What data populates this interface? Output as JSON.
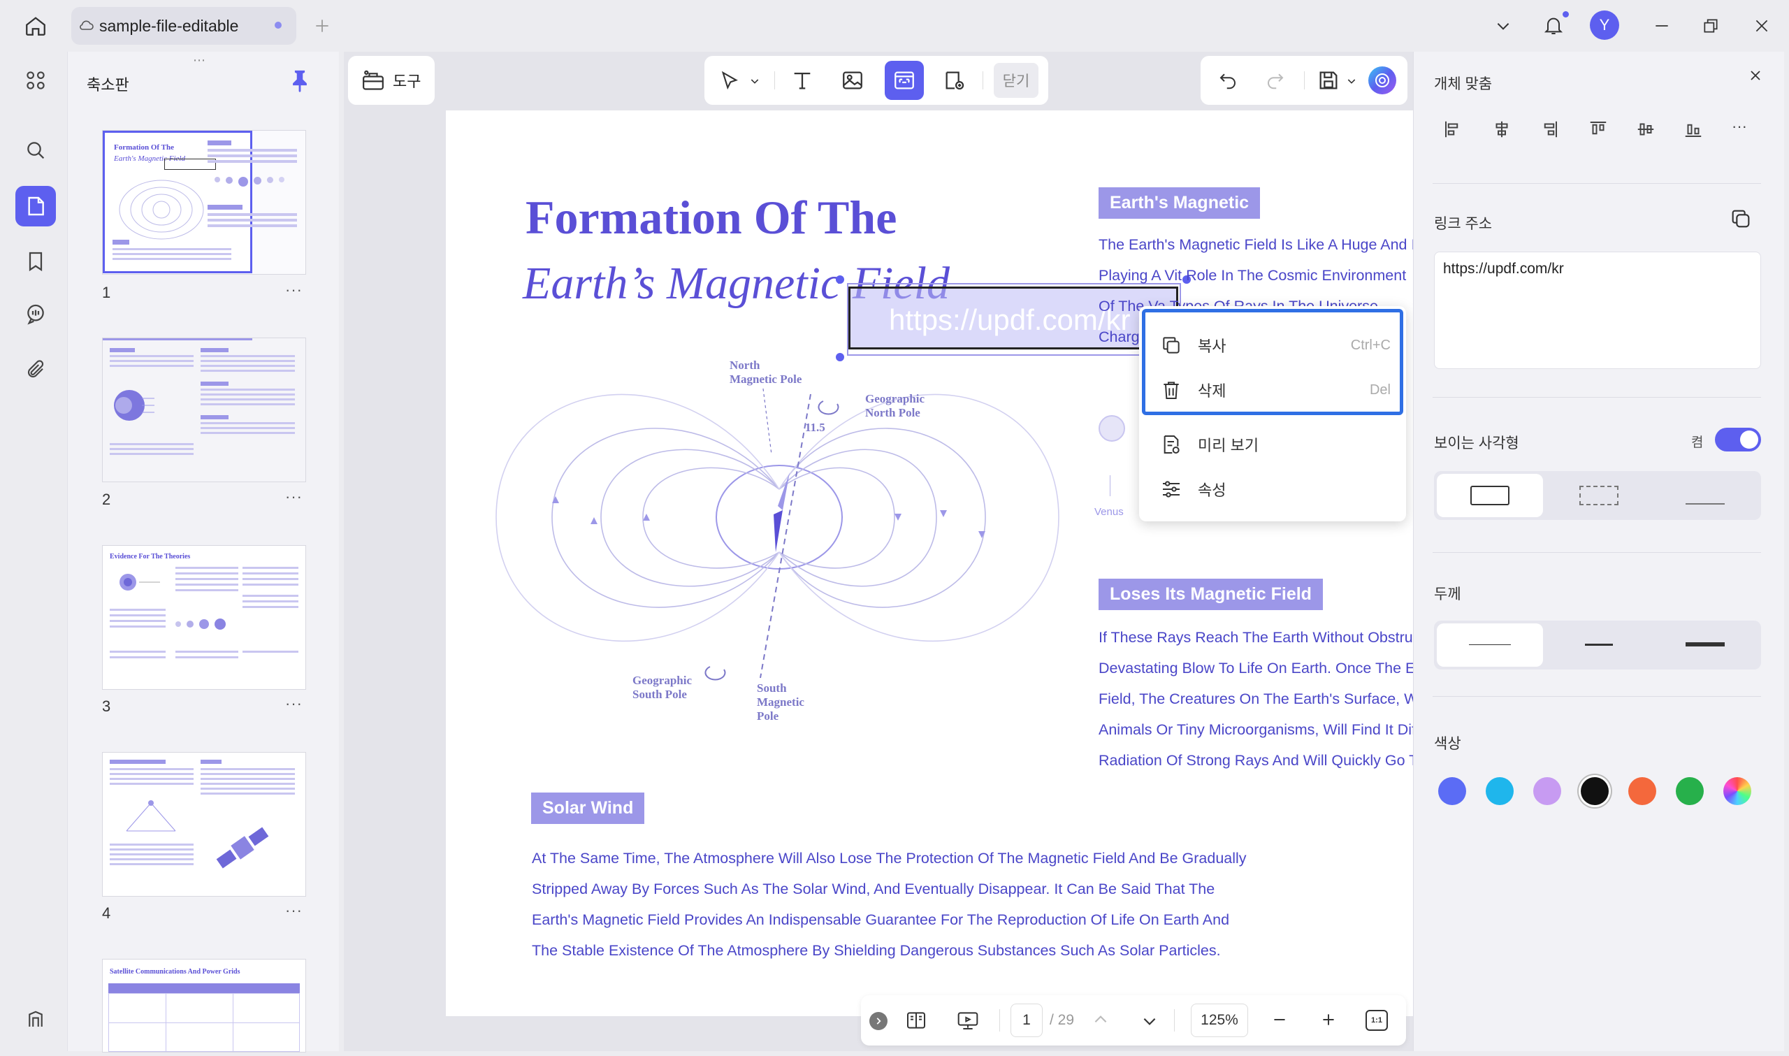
{
  "titlebar": {
    "tab_title": "sample-file-editable",
    "avatar_initial": "Y"
  },
  "thumbnails": {
    "panel_title": "축소판",
    "pages": [
      "1",
      "2",
      "3",
      "4"
    ],
    "more": "···",
    "thumb3_title": "Evidence For The Theories",
    "thumb5_title": "Satellite Communications And Power Grids"
  },
  "toolbar": {
    "tools_label": "도구",
    "close_label": "닫기"
  },
  "document": {
    "title_line1": "Formation Of The",
    "title_line2": "Earth’s Magnetic Field",
    "link_text": "https://updf.com/kr",
    "heading_earth": "Earth's Magnetic",
    "earth_lines": [
      "The Earth's Magnetic Field Is Like A Huge And In",
      "Playing A Vit    Role In The Cosmic Environment",
      "Of The Va          Types Of Rays In The Universe",
      "Charg"
    ],
    "heading_loses": "Loses Its Magnetic Field",
    "loses_lines": [
      "If These Rays Reach The Earth Without Obstruc",
      "Devastating Blow To Life On Earth. Once The Ea",
      "Field, The Creatures On The Earth's Surface, Wh",
      "Animals Or Tiny Microorganisms, Will Find It Diffi",
      "Radiation Of Strong Rays And Will Quickly Go To"
    ],
    "heading_solar": "Solar Wind",
    "solar_lines": [
      "At The Same Time, The Atmosphere Will Also Lose The Protection Of The Magnetic Field And Be Gradually",
      "Stripped Away By Forces Such As The Solar Wind, And Eventually Disappear. It Can Be Said That The",
      "Earth's Magnetic Field Provides An Indispensable Guarantee For The Reproduction Of Life On Earth And",
      "The Stable Existence Of The Atmosphere By Shielding Dangerous Substances Such As Solar Particles."
    ],
    "diagram": {
      "north_magnetic": [
        "North",
        "Magnetic Pole"
      ],
      "geo_north": [
        "Geographic",
        "North Pole"
      ],
      "geo_south": [
        "Geographic",
        "South Pole"
      ],
      "south_magnetic": [
        "South",
        "Magnetic",
        "Pole"
      ],
      "angle": "11.5",
      "venus": "Venus"
    }
  },
  "context_menu": {
    "items": [
      {
        "label": "복사",
        "shortcut": "Ctrl+C"
      },
      {
        "label": "삭제",
        "shortcut": "Del"
      },
      {
        "label": "미리 보기",
        "shortcut": ""
      },
      {
        "label": "속성",
        "shortcut": ""
      }
    ]
  },
  "bottom_nav": {
    "page_current": "1",
    "page_total": "/ 29",
    "zoom": "125%",
    "fit_label": "1:1"
  },
  "properties": {
    "title": "개체 맞춤",
    "more": "···",
    "link_label": "링크 주소",
    "link_value": "https://updf.com/kr",
    "visible_rect_label": "보이는 사각형",
    "toggle_label": "켬",
    "toggle_on": true,
    "thickness_label": "두께",
    "color_label": "색상",
    "colors": [
      "#5b6cf5",
      "#1fb6ec",
      "#c79bf2",
      "#111111",
      "#f4683c",
      "#27b04b",
      "conic"
    ],
    "selected_color": "#111111",
    "accent": "#5d5fef"
  }
}
